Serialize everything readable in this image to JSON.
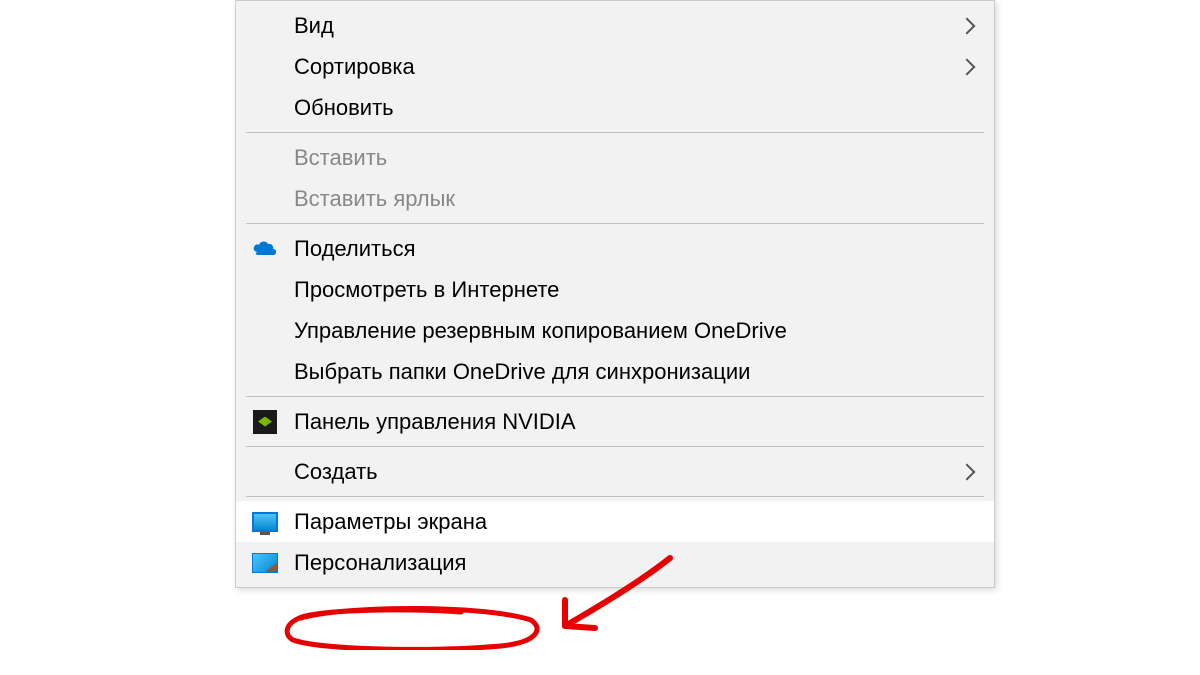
{
  "menu": {
    "items": [
      {
        "label": "Вид",
        "hasSubmenu": true,
        "disabled": false,
        "icon": null
      },
      {
        "label": "Сортировка",
        "hasSubmenu": true,
        "disabled": false,
        "icon": null
      },
      {
        "label": "Обновить",
        "hasSubmenu": false,
        "disabled": false,
        "icon": null
      },
      {
        "type": "separator"
      },
      {
        "label": "Вставить",
        "hasSubmenu": false,
        "disabled": true,
        "icon": null
      },
      {
        "label": "Вставить ярлык",
        "hasSubmenu": false,
        "disabled": true,
        "icon": null
      },
      {
        "type": "separator"
      },
      {
        "label": "Поделиться",
        "hasSubmenu": false,
        "disabled": false,
        "icon": "onedrive"
      },
      {
        "label": "Просмотреть в Интернете",
        "hasSubmenu": false,
        "disabled": false,
        "icon": null
      },
      {
        "label": "Управление резервным копированием OneDrive",
        "hasSubmenu": false,
        "disabled": false,
        "icon": null
      },
      {
        "label": "Выбрать папки OneDrive для синхронизации",
        "hasSubmenu": false,
        "disabled": false,
        "icon": null
      },
      {
        "type": "separator"
      },
      {
        "label": "Панель управления NVIDIA",
        "hasSubmenu": false,
        "disabled": false,
        "icon": "nvidia"
      },
      {
        "type": "separator"
      },
      {
        "label": "Создать",
        "hasSubmenu": true,
        "disabled": false,
        "icon": null
      },
      {
        "type": "separator"
      },
      {
        "label": "Параметры экрана",
        "hasSubmenu": false,
        "disabled": false,
        "icon": "display",
        "highlighted": true
      },
      {
        "label": "Персонализация",
        "hasSubmenu": false,
        "disabled": false,
        "icon": "personalize"
      }
    ]
  },
  "annotation": {
    "color": "#e60000",
    "circledItem": "Параметры экрана"
  }
}
